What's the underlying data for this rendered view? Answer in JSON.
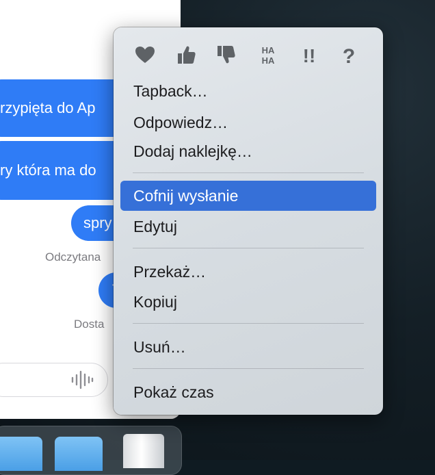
{
  "messages": {
    "bubble1": "rzypięta do Ap",
    "bubble2": "ry która ma do",
    "bubble3": "spry",
    "bubble4": "T",
    "status_read": "Odczytana",
    "status_delivered": "Dosta"
  },
  "menu": {
    "tapbacks": [
      {
        "icon": "heart-icon"
      },
      {
        "icon": "thumbs-up-icon"
      },
      {
        "icon": "thumbs-down-icon"
      },
      {
        "icon": "haha-icon",
        "label": "HA"
      },
      {
        "icon": "exclamation-icon",
        "label": "!!"
      },
      {
        "icon": "question-icon",
        "label": "?"
      }
    ],
    "items": {
      "tapback": "Tapback…",
      "reply": "Odpowiedz…",
      "sticker": "Dodaj naklejkę…",
      "unsend": "Cofnij wysłanie",
      "edit": "Edytuj",
      "forward": "Przekaż…",
      "copy": "Kopiuj",
      "delete": "Usuń…",
      "show_time": "Pokaż czas"
    }
  },
  "colors": {
    "accent": "#3670d8",
    "bubble": "#2f7cf6",
    "menu_text": "#1c1c1e"
  }
}
